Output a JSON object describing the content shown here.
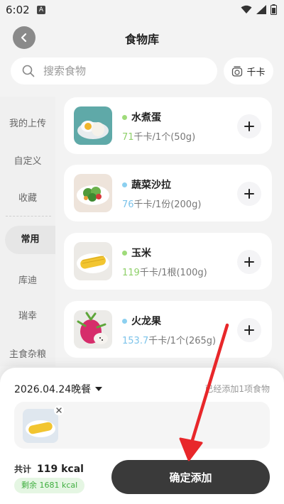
{
  "status": {
    "time": "6:02",
    "notif_letter": "A"
  },
  "header": {
    "title": "食物库"
  },
  "search": {
    "placeholder": "搜索食物",
    "value": ""
  },
  "unit_button": {
    "label": "千卡"
  },
  "sidebar": {
    "items": [
      {
        "label": "我的上传",
        "active": false
      },
      {
        "label": "自定义",
        "active": false
      },
      {
        "label": "收藏",
        "active": false
      },
      {
        "label": "常用",
        "active": true
      },
      {
        "label": "库迪",
        "active": false
      },
      {
        "label": "瑞幸",
        "active": false
      },
      {
        "label": "主食杂粮",
        "active": false
      }
    ]
  },
  "foods": [
    {
      "name": "水煮蛋",
      "kcal": "71",
      "unit": "千卡/1个(50g)",
      "dot_color": "#9fdb7a",
      "kcal_color": "#8fd06a",
      "icon": "boiled-egg-icon"
    },
    {
      "name": "蔬菜沙拉",
      "kcal": "76",
      "unit": "千卡/1份(200g)",
      "dot_color": "#8cd0f0",
      "kcal_color": "#7cc3ea",
      "icon": "salad-icon"
    },
    {
      "name": "玉米",
      "kcal": "119",
      "unit": "千卡/1根(100g)",
      "dot_color": "#9fdb7a",
      "kcal_color": "#8fd06a",
      "icon": "corn-icon"
    },
    {
      "name": "火龙果",
      "kcal": "153.7",
      "unit": "千卡/1个(265g)",
      "dot_color": "#8cd0f0",
      "kcal_color": "#7cc3ea",
      "icon": "dragon-fruit-icon"
    }
  ],
  "bottom": {
    "meal": "2026.04.24晚餐",
    "added_text": "已经添加1项食物",
    "total_label": "共计",
    "total_value": "119 kcal",
    "remaining": "剩余 1681 kcal",
    "confirm_label": "确定添加"
  },
  "colors": {
    "accent_green": "#3fae3f",
    "button_dark": "#3a3a3a",
    "annotation_red": "#e8272a"
  }
}
